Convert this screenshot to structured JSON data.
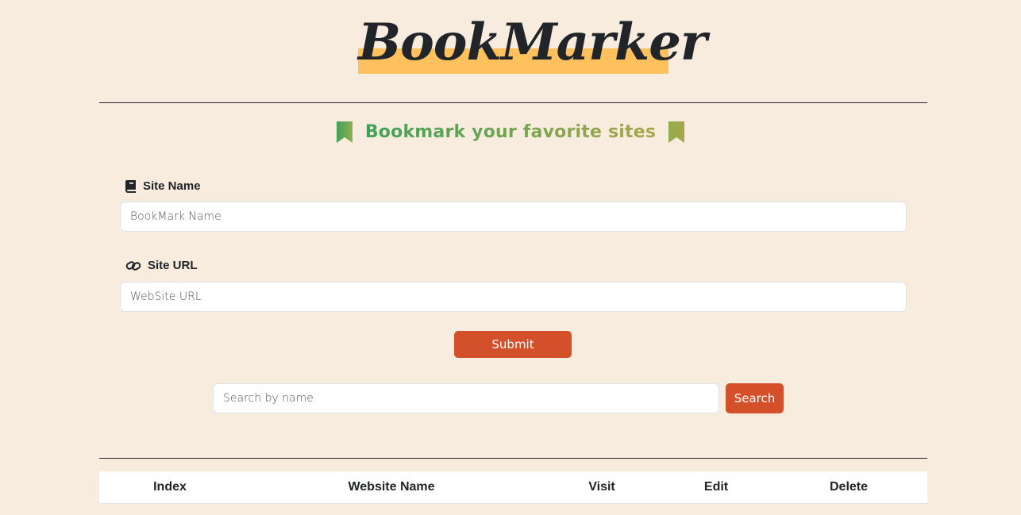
{
  "header": {
    "logo_text": "BookMarker",
    "logo_band_color": "#ffc15e"
  },
  "form": {
    "subtitle": "Bookmark your favorite sites",
    "subtitle_icon": "bookmark-ribbon-icon",
    "site_name": {
      "label": "Site Name",
      "icon": "book-icon",
      "placeholder": "BookMark Name",
      "value": ""
    },
    "site_url": {
      "label": "Site URL",
      "icon": "link-icon",
      "placeholder": "WebSite URL",
      "value": ""
    },
    "submit_label": "Submit"
  },
  "search": {
    "placeholder": "Search by name",
    "button_label": "Search"
  },
  "table": {
    "columns": [
      "Index",
      "Website Name",
      "Visit",
      "Edit",
      "Delete"
    ]
  },
  "colors": {
    "background": "#f8ecdf",
    "accent": "#d4502b",
    "gradient_start": "#3fa25a",
    "gradient_end": "#a9a64a"
  }
}
